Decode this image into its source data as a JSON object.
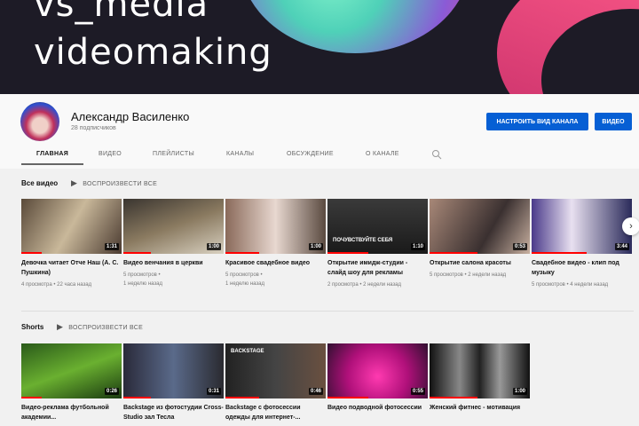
{
  "banner": {
    "line1": "vs_media",
    "line2": "videomaking"
  },
  "channel": {
    "name": "Александр Василенко",
    "subscribers": "28 подписчиков"
  },
  "buttons": {
    "customize": "НАСТРОИТЬ ВИД КАНАЛА",
    "videos": "ВИДЕО"
  },
  "tabs": [
    "ГЛАВНАЯ",
    "ВИДЕО",
    "ПЛЕЙЛИСТЫ",
    "КАНАЛЫ",
    "ОБСУЖДЕНИЕ",
    "О КАНАЛЕ"
  ],
  "sections": {
    "all_videos": "Все видео",
    "shorts": "Shorts",
    "play_all": "ВОСПРОИЗВЕСТИ ВСЕ"
  },
  "videos": [
    {
      "title": "Девочка читает Отче Наш (А. С. Пушкина)",
      "meta1": "4 просмотра • 22 часа назад",
      "meta2": "",
      "duration": "1:31",
      "bg": "linear-gradient(120deg,#5a4a3a,#c9b89a 50%,#4a3a30)"
    },
    {
      "title": "Видео венчания в церкви",
      "meta1": "5 просмотров •",
      "meta2": "1 неделю назад",
      "duration": "1:00",
      "bg": "linear-gradient(160deg,#3a3530,#8a7a60 50%,#d8d0c0)"
    },
    {
      "title": "Красивое свадебное видео",
      "meta1": "5 просмотров •",
      "meta2": "1 неделю назад",
      "duration": "1:00",
      "bg": "linear-gradient(90deg,#8a6a5a,#e8d8d0 50%,#5a4a40)"
    },
    {
      "title": "Открытие имидж-студии - слайд шоу для рекламы",
      "meta1": "2 просмотра • 2 недели назад",
      "meta2": "",
      "duration": "1:10",
      "bg": "linear-gradient(180deg,#3a3a3a,#1a1a1a)",
      "caption": "ПОЧУВСТВУЙТЕ СЕБЯ"
    },
    {
      "title": "Открытие салона красоты",
      "meta1": "5 просмотров • 2 недели назад",
      "meta2": "",
      "duration": "0:53",
      "bg": "linear-gradient(120deg,#a88878,#3a3030 60%,#c8b0a0)"
    },
    {
      "title": "Свадебное видео - клип под музыку",
      "meta1": "5 просмотров • 4 недели назад",
      "meta2": "",
      "duration": "3:44",
      "bg": "linear-gradient(90deg,#4a3a8a,#e8e0f0 40%,#2a2a5a)"
    }
  ],
  "shorts": [
    {
      "title": "Видео-реклама футбольной академии...",
      "duration": "0:26",
      "bg": "linear-gradient(160deg,#2a5a1a,#6ab030 50%,#1a3a10)"
    },
    {
      "title": "Backstage из фотостудии Cross-Studio зал Тесла",
      "duration": "0:31",
      "bg": "linear-gradient(90deg,#2a2a3a,#5a6a8a 50%,#2a2a30)"
    },
    {
      "title": "Backstage с фотосессии одежды для интернет-...",
      "duration": "0:46",
      "bg": "linear-gradient(90deg,#222,#444 50%,#6a5040)",
      "caption": "BACKSTAGE"
    },
    {
      "title": "Видео подводной фотосессии",
      "duration": "0:55",
      "bg": "radial-gradient(circle at 50% 60%,#ff3ab0,#b0107a 50%,#301030)"
    },
    {
      "title": "Женский фитнес - мотивация",
      "duration": "1:00",
      "bg": "linear-gradient(90deg,#111,#888 30%,#222 50%,#999 70%,#111)"
    }
  ]
}
